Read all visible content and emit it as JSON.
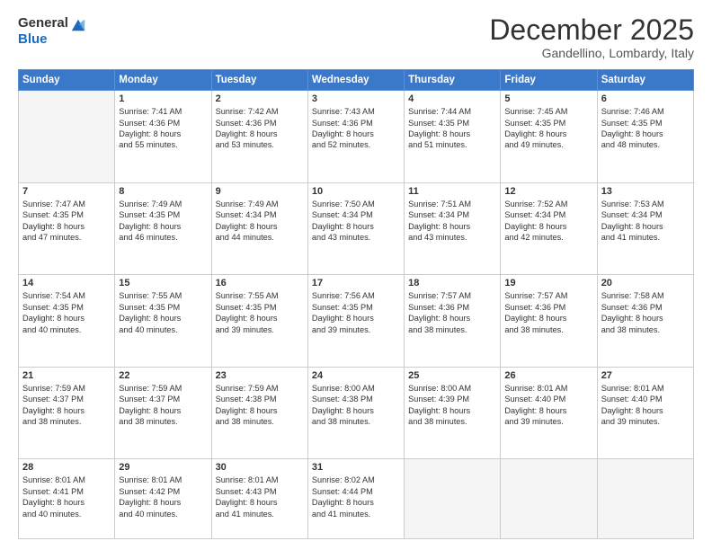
{
  "logo": {
    "general": "General",
    "blue": "Blue"
  },
  "title": "December 2025",
  "location": "Gandellino, Lombardy, Italy",
  "headers": [
    "Sunday",
    "Monday",
    "Tuesday",
    "Wednesday",
    "Thursday",
    "Friday",
    "Saturday"
  ],
  "weeks": [
    [
      {
        "day": "",
        "empty": true
      },
      {
        "day": "1",
        "sunrise": "7:41 AM",
        "sunset": "4:36 PM",
        "daylight": "8 hours and 55 minutes."
      },
      {
        "day": "2",
        "sunrise": "7:42 AM",
        "sunset": "4:36 PM",
        "daylight": "8 hours and 53 minutes."
      },
      {
        "day": "3",
        "sunrise": "7:43 AM",
        "sunset": "4:36 PM",
        "daylight": "8 hours and 52 minutes."
      },
      {
        "day": "4",
        "sunrise": "7:44 AM",
        "sunset": "4:35 PM",
        "daylight": "8 hours and 51 minutes."
      },
      {
        "day": "5",
        "sunrise": "7:45 AM",
        "sunset": "4:35 PM",
        "daylight": "8 hours and 49 minutes."
      },
      {
        "day": "6",
        "sunrise": "7:46 AM",
        "sunset": "4:35 PM",
        "daylight": "8 hours and 48 minutes."
      }
    ],
    [
      {
        "day": "7",
        "sunrise": "7:47 AM",
        "sunset": "4:35 PM",
        "daylight": "8 hours and 47 minutes."
      },
      {
        "day": "8",
        "sunrise": "7:49 AM",
        "sunset": "4:35 PM",
        "daylight": "8 hours and 46 minutes."
      },
      {
        "day": "9",
        "sunrise": "7:49 AM",
        "sunset": "4:34 PM",
        "daylight": "8 hours and 44 minutes."
      },
      {
        "day": "10",
        "sunrise": "7:50 AM",
        "sunset": "4:34 PM",
        "daylight": "8 hours and 43 minutes."
      },
      {
        "day": "11",
        "sunrise": "7:51 AM",
        "sunset": "4:34 PM",
        "daylight": "8 hours and 43 minutes."
      },
      {
        "day": "12",
        "sunrise": "7:52 AM",
        "sunset": "4:34 PM",
        "daylight": "8 hours and 42 minutes."
      },
      {
        "day": "13",
        "sunrise": "7:53 AM",
        "sunset": "4:34 PM",
        "daylight": "8 hours and 41 minutes."
      }
    ],
    [
      {
        "day": "14",
        "sunrise": "7:54 AM",
        "sunset": "4:35 PM",
        "daylight": "8 hours and 40 minutes."
      },
      {
        "day": "15",
        "sunrise": "7:55 AM",
        "sunset": "4:35 PM",
        "daylight": "8 hours and 40 minutes."
      },
      {
        "day": "16",
        "sunrise": "7:55 AM",
        "sunset": "4:35 PM",
        "daylight": "8 hours and 39 minutes."
      },
      {
        "day": "17",
        "sunrise": "7:56 AM",
        "sunset": "4:35 PM",
        "daylight": "8 hours and 39 minutes."
      },
      {
        "day": "18",
        "sunrise": "7:57 AM",
        "sunset": "4:36 PM",
        "daylight": "8 hours and 38 minutes."
      },
      {
        "day": "19",
        "sunrise": "7:57 AM",
        "sunset": "4:36 PM",
        "daylight": "8 hours and 38 minutes."
      },
      {
        "day": "20",
        "sunrise": "7:58 AM",
        "sunset": "4:36 PM",
        "daylight": "8 hours and 38 minutes."
      }
    ],
    [
      {
        "day": "21",
        "sunrise": "7:59 AM",
        "sunset": "4:37 PM",
        "daylight": "8 hours and 38 minutes."
      },
      {
        "day": "22",
        "sunrise": "7:59 AM",
        "sunset": "4:37 PM",
        "daylight": "8 hours and 38 minutes."
      },
      {
        "day": "23",
        "sunrise": "7:59 AM",
        "sunset": "4:38 PM",
        "daylight": "8 hours and 38 minutes."
      },
      {
        "day": "24",
        "sunrise": "8:00 AM",
        "sunset": "4:38 PM",
        "daylight": "8 hours and 38 minutes."
      },
      {
        "day": "25",
        "sunrise": "8:00 AM",
        "sunset": "4:39 PM",
        "daylight": "8 hours and 38 minutes."
      },
      {
        "day": "26",
        "sunrise": "8:01 AM",
        "sunset": "4:40 PM",
        "daylight": "8 hours and 39 minutes."
      },
      {
        "day": "27",
        "sunrise": "8:01 AM",
        "sunset": "4:40 PM",
        "daylight": "8 hours and 39 minutes."
      }
    ],
    [
      {
        "day": "28",
        "sunrise": "8:01 AM",
        "sunset": "4:41 PM",
        "daylight": "8 hours and 40 minutes."
      },
      {
        "day": "29",
        "sunrise": "8:01 AM",
        "sunset": "4:42 PM",
        "daylight": "8 hours and 40 minutes."
      },
      {
        "day": "30",
        "sunrise": "8:01 AM",
        "sunset": "4:43 PM",
        "daylight": "8 hours and 41 minutes."
      },
      {
        "day": "31",
        "sunrise": "8:02 AM",
        "sunset": "4:44 PM",
        "daylight": "8 hours and 41 minutes."
      },
      {
        "day": "",
        "empty": true
      },
      {
        "day": "",
        "empty": true
      },
      {
        "day": "",
        "empty": true
      }
    ]
  ]
}
